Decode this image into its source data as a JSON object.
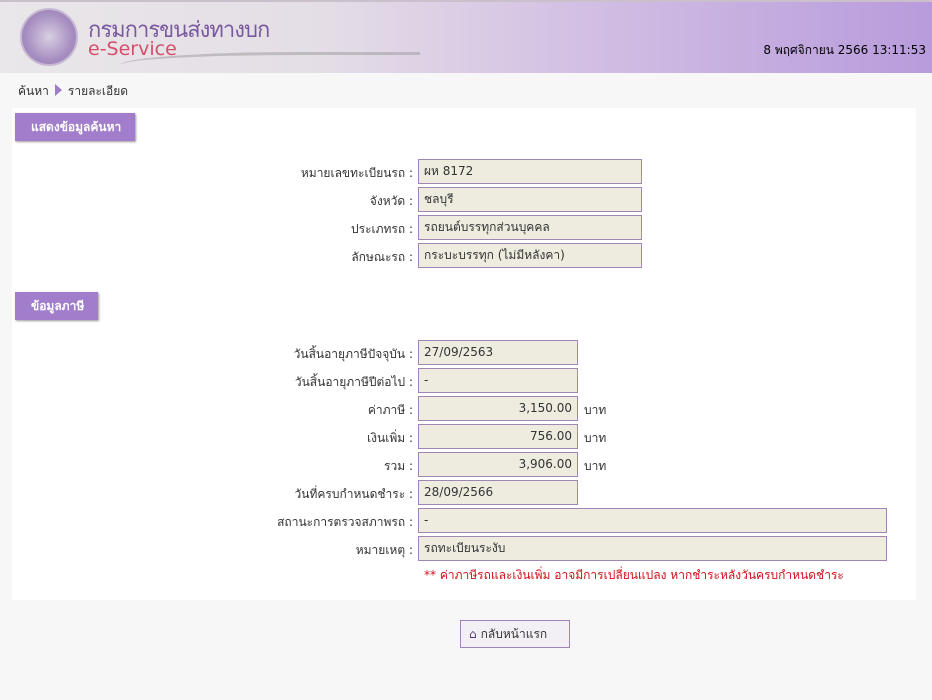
{
  "header": {
    "brand_th": "กรมการขนส่งทางบก",
    "brand_en": "e-Service",
    "datetime": "8 พฤศจิกายน 2566 13:11:53"
  },
  "breadcrumb": {
    "items": [
      "ค้นหา",
      "รายละเอียด"
    ]
  },
  "section1": {
    "title": "แสดงข้อมูลค้นหา",
    "fields": [
      {
        "label": "หมายเลขทะเบียนรถ :",
        "value": "ผห 8172"
      },
      {
        "label": "จังหวัด :",
        "value": "ชลบุรี"
      },
      {
        "label": "ประเภทรถ :",
        "value": "รถยนต์บรรทุกส่วนบุคคล"
      },
      {
        "label": "ลักษณะรถ :",
        "value": "กระบะบรรทุก (ไม่มีหลังคา)"
      }
    ]
  },
  "section2": {
    "title": "ข้อมูลภาษี",
    "fields": [
      {
        "label": "วันสิ้นอายุภาษีปัจจุบัน :",
        "value": "27/09/2563"
      },
      {
        "label": "วันสิ้นอายุภาษีปีต่อไป :",
        "value": "-"
      },
      {
        "label": "ค่าภาษี :",
        "value": "3,150.00",
        "unit": "บาท"
      },
      {
        "label": "เงินเพิ่ม :",
        "value": "756.00",
        "unit": "บาท"
      },
      {
        "label": "รวม :",
        "value": "3,906.00",
        "unit": "บาท"
      },
      {
        "label": "วันที่ครบกำหนดชำระ :",
        "value": "28/09/2566"
      },
      {
        "label": "สถานะการตรวจสภาพรถ :",
        "value": "-"
      },
      {
        "label": "หมายเหตุ :",
        "value": "รถทะเบียนระงับ"
      }
    ],
    "note": "** ค่าภาษีรถและเงินเพิ่ม อาจมีการเปลี่ยนแปลง หากชำระหลังวันครบกำหนดชำระ"
  },
  "buttons": {
    "home": "กลับหน้าแรก",
    "home_icon": "home-icon"
  },
  "colors": {
    "accent": "#a27dcb",
    "field_bg": "#eeecdf",
    "note": "#d0101a"
  }
}
